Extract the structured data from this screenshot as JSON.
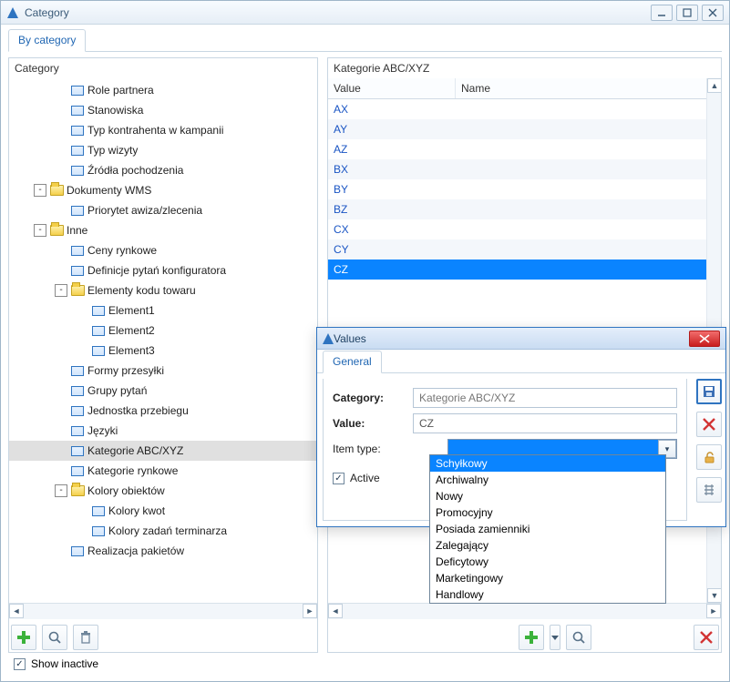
{
  "window": {
    "title": "Category"
  },
  "tabs": {
    "by_category": "By category"
  },
  "left": {
    "header": "Category",
    "nodes": [
      {
        "depth": 2,
        "type": "item",
        "label": "Role partnera"
      },
      {
        "depth": 2,
        "type": "item",
        "label": "Stanowiska"
      },
      {
        "depth": 2,
        "type": "item",
        "label": "Typ kontrahenta w kampanii"
      },
      {
        "depth": 2,
        "type": "item",
        "label": "Typ wizyty"
      },
      {
        "depth": 2,
        "type": "item",
        "label": "Źródła pochodzenia"
      },
      {
        "depth": 1,
        "type": "folder",
        "label": "Dokumenty WMS",
        "toggle": "-"
      },
      {
        "depth": 2,
        "type": "item",
        "label": "Priorytet awiza/zlecenia"
      },
      {
        "depth": 1,
        "type": "folder",
        "label": "Inne",
        "toggle": "-"
      },
      {
        "depth": 2,
        "type": "item",
        "label": "Ceny rynkowe"
      },
      {
        "depth": 2,
        "type": "item",
        "label": "Definicje pytań konfiguratora"
      },
      {
        "depth": 2,
        "type": "folder",
        "label": "Elementy kodu towaru",
        "toggle": "-"
      },
      {
        "depth": 3,
        "type": "item",
        "label": "Element1"
      },
      {
        "depth": 3,
        "type": "item",
        "label": "Element2"
      },
      {
        "depth": 3,
        "type": "item",
        "label": "Element3"
      },
      {
        "depth": 2,
        "type": "item",
        "label": "Formy przesyłki"
      },
      {
        "depth": 2,
        "type": "item",
        "label": "Grupy pytań"
      },
      {
        "depth": 2,
        "type": "item",
        "label": "Jednostka przebiegu"
      },
      {
        "depth": 2,
        "type": "item",
        "label": "Języki"
      },
      {
        "depth": 2,
        "type": "item",
        "label": "Kategorie ABC/XYZ",
        "selected": true
      },
      {
        "depth": 2,
        "type": "item",
        "label": "Kategorie rynkowe"
      },
      {
        "depth": 2,
        "type": "folder",
        "label": "Kolory obiektów",
        "toggle": "-"
      },
      {
        "depth": 3,
        "type": "item",
        "label": "Kolory kwot"
      },
      {
        "depth": 3,
        "type": "item",
        "label": "Kolory zadań terminarza"
      },
      {
        "depth": 2,
        "type": "item",
        "label": "Realizacja pakietów"
      }
    ]
  },
  "right": {
    "header": "Kategorie ABC/XYZ",
    "columns": {
      "value": "Value",
      "name": "Name"
    },
    "rows": [
      {
        "value": "AX",
        "name": ""
      },
      {
        "value": "AY",
        "name": ""
      },
      {
        "value": "AZ",
        "name": ""
      },
      {
        "value": "BX",
        "name": ""
      },
      {
        "value": "BY",
        "name": ""
      },
      {
        "value": "BZ",
        "name": ""
      },
      {
        "value": "CX",
        "name": ""
      },
      {
        "value": "CY",
        "name": ""
      },
      {
        "value": "CZ",
        "name": "",
        "selected": true
      }
    ]
  },
  "dialog": {
    "title": "Values",
    "tab": "General",
    "category_label": "Category:",
    "category_value": "Kategorie ABC/XYZ",
    "value_label": "Value:",
    "value_value": "CZ",
    "itemtype_label": "Item type:",
    "active_label": "Active",
    "active_checked": true,
    "options": [
      "Schyłkowy",
      "Archiwalny",
      "Nowy",
      "Promocyjny",
      "Posiada zamienniki",
      "Zalegający",
      "Deficytowy",
      "Marketingowy",
      "Handlowy"
    ]
  },
  "footer": {
    "show_inactive_label": "Show inactive",
    "show_inactive_checked": true
  }
}
